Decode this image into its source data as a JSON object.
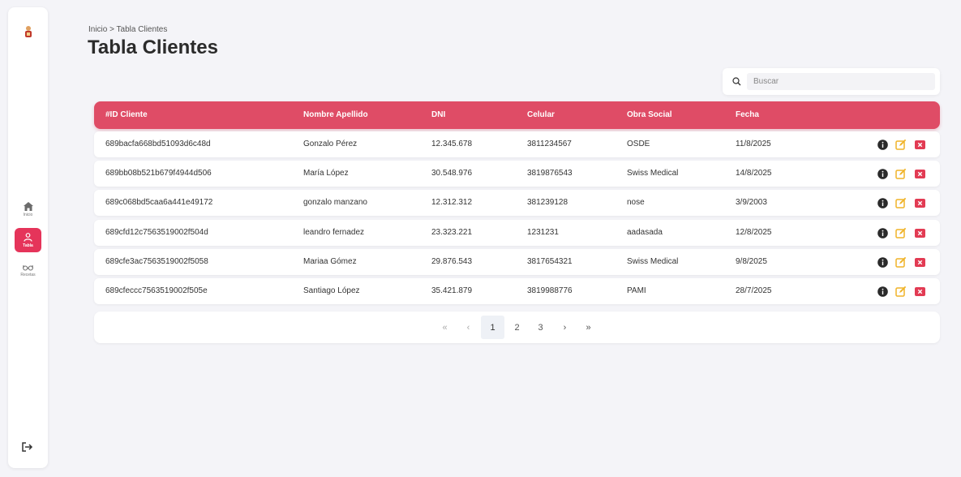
{
  "sidebar": {
    "items": [
      {
        "label": "Inicio"
      },
      {
        "label": "Tabla"
      },
      {
        "label": "Recetas"
      }
    ]
  },
  "breadcrumb": "Inicio > Tabla Clientes",
  "title": "Tabla Clientes",
  "search": {
    "placeholder": "Buscar",
    "value": ""
  },
  "table": {
    "columns": [
      "#ID Cliente",
      "Nombre Apellido",
      "DNI",
      "Celular",
      "Obra Social",
      "Fecha"
    ],
    "rows": [
      [
        "689bacfa668bd51093d6c48d",
        "Gonzalo Pérez",
        "12.345.678",
        "3811234567",
        "OSDE",
        "11/8/2025"
      ],
      [
        "689bb08b521b679f4944d506",
        "María López",
        "30.548.976",
        "3819876543",
        "Swiss Medical",
        "14/8/2025"
      ],
      [
        "689c068bd5caa6a441e49172",
        "gonzalo manzano",
        "12.312.312",
        "381239128",
        "nose",
        "3/9/2003"
      ],
      [
        "689cfd12c7563519002f504d",
        "leandro fernadez",
        "23.323.221",
        "1231231",
        "aadasada",
        "12/8/2025"
      ],
      [
        "689cfe3ac7563519002f5058",
        "Mariaa Gómez",
        "29.876.543",
        "3817654321",
        "Swiss Medical",
        "9/8/2025"
      ],
      [
        "689cfeccc7563519002f505e",
        "Santiago López",
        "35.421.879",
        "3819988776",
        "PAMI",
        "28/7/2025"
      ]
    ]
  },
  "pagination": {
    "first": "«",
    "prev": "‹",
    "pages": [
      "1",
      "2",
      "3"
    ],
    "current": "1",
    "next": "›",
    "last": "»"
  },
  "colors": {
    "accent": "#e5345a",
    "header": "#df4c66",
    "info": "#2a2a2a",
    "edit": "#f0b429",
    "delete": "#e23b53"
  }
}
